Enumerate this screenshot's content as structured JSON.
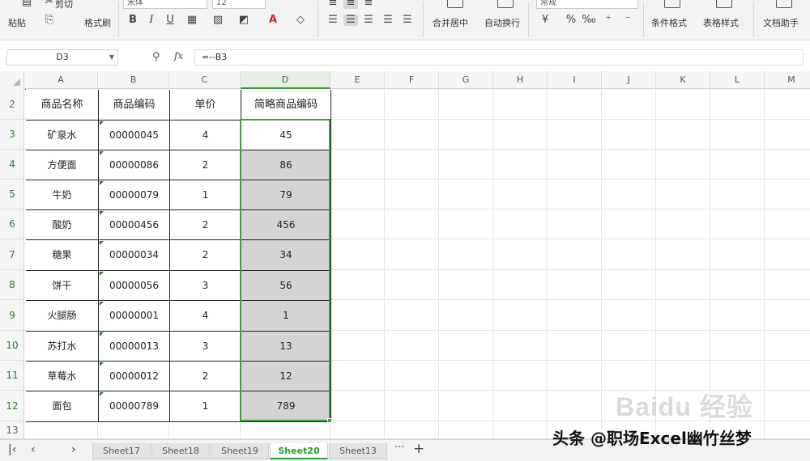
{
  "ribbon": {
    "paste_label": "粘贴",
    "cut_label": "剪切",
    "format_painter_label": "格式刷",
    "font_name": "宋体",
    "font_size": "12",
    "bold": "B",
    "italic": "I",
    "underline": "U",
    "merge_label": "合并居中",
    "wrap_label": "自动换行",
    "number_format": "常规",
    "percent": "%",
    "cond_format_label": "条件格式",
    "table_style_label": "表格样式",
    "doc_helper_label": "文档助手"
  },
  "formula_bar": {
    "name_box": "D3",
    "fx": "fx",
    "formula": "=--B3"
  },
  "columns": [
    "A",
    "B",
    "C",
    "D",
    "E",
    "F",
    "G",
    "H",
    "I",
    "J",
    "K",
    "L",
    "M"
  ],
  "rows": [
    "2",
    "3",
    "4",
    "5",
    "6",
    "7",
    "8",
    "9",
    "10",
    "11",
    "12",
    "13"
  ],
  "table": {
    "headers": [
      "商品名称",
      "商品编码",
      "单价",
      "简略商品编码"
    ],
    "rows": [
      [
        "矿泉水",
        "00000045",
        "4",
        "45"
      ],
      [
        "方便面",
        "00000086",
        "2",
        "86"
      ],
      [
        "牛奶",
        "00000079",
        "1",
        "79"
      ],
      [
        "酸奶",
        "00000456",
        "2",
        "456"
      ],
      [
        "糖果",
        "00000034",
        "2",
        "34"
      ],
      [
        "饼干",
        "00000056",
        "3",
        "56"
      ],
      [
        "火腿肠",
        "00000001",
        "4",
        "1"
      ],
      [
        "苏打水",
        "00000013",
        "3",
        "13"
      ],
      [
        "草莓水",
        "00000012",
        "2",
        "12"
      ],
      [
        "面包",
        "00000789",
        "1",
        "789"
      ]
    ]
  },
  "sheets": [
    "Sheet17",
    "Sheet18",
    "Sheet19",
    "Sheet20",
    "Sheet13"
  ],
  "active_sheet": "Sheet20",
  "tab_more": "···",
  "tab_add": "+",
  "watermark": "头条 @职场Excel幽竹丝梦",
  "baidu_watermark": "Baidu 经验",
  "colors": {
    "selection": "#3aa13a",
    "shaded_cell": "#d4d4d4",
    "active_tab": "#2b9a2b"
  }
}
